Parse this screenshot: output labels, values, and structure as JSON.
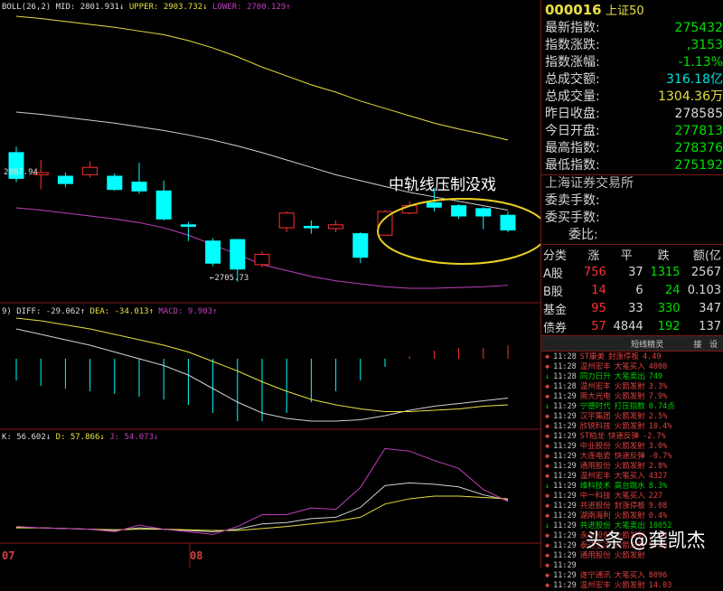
{
  "boll_panel": {
    "label_name": "BOLL(26,2)",
    "mid": "MID: 2801.931↓",
    "upper": "UPPER: 2903.732↓",
    "lower": "LOWER: 2700.129↑",
    "high_mark": "2887.94",
    "low_mark": "←2705.73",
    "annotation": "中轨线压制没戏"
  },
  "macd_panel": {
    "prefix": "9)",
    "diff": "DIFF: -29.062↑",
    "dea": "DEA: -34.013↑",
    "macd": "MACD: 9.903↑"
  },
  "kdj_panel": {
    "k": "K: 56.602↓",
    "d": "D: 57.866↓",
    "j": "J: 54.073↓"
  },
  "date_axis": [
    "07",
    "08"
  ],
  "quote": {
    "code": "000016",
    "name": "上证50",
    "rows": [
      {
        "label": "最新指数:",
        "value": "275432",
        "color": "#00e000"
      },
      {
        "label": "指数涨跌:",
        "value": ",3153",
        "color": "#00e000"
      },
      {
        "label": "指数涨幅:",
        "value": "-1.13%",
        "color": "#00e000"
      },
      {
        "label": "总成交额:",
        "value": "316.18亿",
        "color": "#00e0e0"
      },
      {
        "label": "总成交量:",
        "value": "1304.36万",
        "color": "#e8e040"
      },
      {
        "label": "昨日收盘:",
        "value": "278585",
        "color": "#d8d8d8"
      },
      {
        "label": "今日开盘:",
        "value": "277813",
        "color": "#00e000"
      },
      {
        "label": "最高指数:",
        "value": "278376",
        "color": "#00e000"
      },
      {
        "label": "最低指数:",
        "value": "275192",
        "color": "#00e000"
      }
    ],
    "exchange": "上海证券交易所",
    "order_rows": [
      {
        "label": "委卖手数:"
      },
      {
        "label": "委买手数:"
      },
      {
        "label": "委比:"
      }
    ]
  },
  "category_table": {
    "headers": [
      "分类",
      "涨",
      "平",
      "跌",
      "额(亿"
    ],
    "rows": [
      {
        "name": "A股",
        "up": "756",
        "flat": "37",
        "down": "1315",
        "amount": "2567"
      },
      {
        "name": "B股",
        "up": "14",
        "flat": "6",
        "down": "24",
        "amount": "0.103"
      },
      {
        "name": "基金",
        "up": "95",
        "flat": "33",
        "down": "330",
        "amount": "347"
      },
      {
        "name": "债券",
        "up": "57",
        "flat": "4844",
        "down": "192",
        "amount": "137"
      }
    ]
  },
  "short_elves": {
    "title": "短线精灵",
    "right_a": "接",
    "right_b": "设",
    "items": [
      {
        "time": "11:28",
        "name": "ST康美",
        "event": "封涨停板",
        "val": "4.49",
        "color": "#e04040"
      },
      {
        "time": "11:28",
        "name": "温州宏丰",
        "event": "大笔买入",
        "val": "4000",
        "color": "#e04040"
      },
      {
        "time": "11:28",
        "name": "同力日升",
        "event": "大笔卖出",
        "val": "749",
        "color": "#00d000"
      },
      {
        "time": "11:28",
        "name": "温州宏丰",
        "event": "火箭发射",
        "val": "3.3%",
        "color": "#e04040"
      },
      {
        "time": "11:29",
        "name": "南大光电",
        "event": "火箭发射",
        "val": "7.9%",
        "color": "#e04040"
      },
      {
        "time": "11:29",
        "name": "宁德时代",
        "event": "打压指数",
        "val": "0.74点",
        "color": "#00d000"
      },
      {
        "time": "11:29",
        "name": "汉宇集团",
        "event": "火箭发射",
        "val": "2.5%",
        "color": "#e04040"
      },
      {
        "time": "11:29",
        "name": "欣锐科技",
        "event": "火箭发射",
        "val": "10.4%",
        "color": "#e04040"
      },
      {
        "time": "11:29",
        "name": "ST柏龙",
        "event": "快速反弹",
        "val": "-2.7%",
        "color": "#e04040"
      },
      {
        "time": "11:29",
        "name": "中业股份",
        "event": "火箭发射",
        "val": "3.0%",
        "color": "#e04040"
      },
      {
        "time": "11:29",
        "name": "大连电瓷",
        "event": "快速反弹",
        "val": "-0.7%",
        "color": "#e04040"
      },
      {
        "time": "11:29",
        "name": "通用股份",
        "event": "火箭发射",
        "val": "2.8%",
        "color": "#e04040"
      },
      {
        "time": "11:29",
        "name": "温州宏丰",
        "event": "大笔买入",
        "val": "4327",
        "color": "#e04040"
      },
      {
        "time": "11:29",
        "name": "维科技术",
        "event": "高台跳水",
        "val": "8.3%",
        "color": "#00d000"
      },
      {
        "time": "11:29",
        "name": "中一科技",
        "event": "大笔买入",
        "val": "227",
        "color": "#e04040"
      },
      {
        "time": "11:29",
        "name": "共进股份",
        "event": "封涨停板",
        "val": "9.08",
        "color": "#e04040"
      },
      {
        "time": "11:29",
        "name": "湖南海利",
        "event": "火箭发射",
        "val": "0.4%",
        "color": "#e04040"
      },
      {
        "time": "11:29",
        "name": "共进股份",
        "event": "大笔卖出",
        "val": "10052",
        "color": "#00d000"
      },
      {
        "time": "11:29",
        "name": "永吉股份",
        "event": "火箭发射",
        "val": "1.2%",
        "color": "#e04040"
      },
      {
        "time": "11:29",
        "name": "泰达生活",
        "event": "火箭发射",
        "val": "9.2%",
        "color": "#e04040"
      },
      {
        "time": "11:29",
        "name": "通用股份",
        "event": "火箭发射",
        "val": "",
        "color": "#e04040"
      },
      {
        "time": "11:29",
        "name": "",
        "event": "",
        "val": "",
        "color": "#e04040"
      },
      {
        "time": "11:29",
        "name": "遂宁通讯",
        "event": "大笔买入",
        "val": "8096",
        "color": "#e04040"
      },
      {
        "time": "11:29",
        "name": "温州宏丰",
        "event": "火箭发射",
        "val": "14.03",
        "color": "#e04040"
      }
    ]
  },
  "watermark": "头条 @龚凯杰",
  "colors": {
    "up": "#ff3030",
    "down": "#00ffff",
    "mid_line": "#d0d0d0",
    "upper_line": "#e8e040",
    "lower_line": "#c040c0",
    "ellipse": "#e8d020"
  },
  "chart_data": {
    "type": "candlestick",
    "candles": [
      {
        "open": 2880,
        "close": 2845,
        "high": 2888,
        "low": 2840
      },
      {
        "open": 2850,
        "close": 2853,
        "high": 2870,
        "low": 2830
      },
      {
        "open": 2848,
        "close": 2838,
        "high": 2853,
        "low": 2833
      },
      {
        "open": 2850,
        "close": 2860,
        "high": 2868,
        "low": 2846
      },
      {
        "open": 2848,
        "close": 2830,
        "high": 2852,
        "low": 2828
      },
      {
        "open": 2840,
        "close": 2828,
        "high": 2866,
        "low": 2824
      },
      {
        "open": 2828,
        "close": 2790,
        "high": 2842,
        "low": 2788
      },
      {
        "open": 2782,
        "close": 2780,
        "high": 2786,
        "low": 2760
      },
      {
        "open": 2760,
        "close": 2730,
        "high": 2764,
        "low": 2726
      },
      {
        "open": 2762,
        "close": 2722,
        "high": 2763,
        "low": 2705
      },
      {
        "open": 2728,
        "close": 2742,
        "high": 2746,
        "low": 2724
      },
      {
        "open": 2778,
        "close": 2798,
        "high": 2800,
        "low": 2772
      },
      {
        "open": 2780,
        "close": 2778,
        "high": 2788,
        "low": 2770
      },
      {
        "open": 2777,
        "close": 2782,
        "high": 2788,
        "low": 2772
      },
      {
        "open": 2770,
        "close": 2738,
        "high": 2772,
        "low": 2730
      },
      {
        "open": 2768,
        "close": 2800,
        "high": 2802,
        "low": 2768
      },
      {
        "open": 2798,
        "close": 2808,
        "high": 2814,
        "low": 2796
      },
      {
        "open": 2812,
        "close": 2806,
        "high": 2832,
        "low": 2800
      },
      {
        "open": 2808,
        "close": 2794,
        "high": 2810,
        "low": 2790
      },
      {
        "open": 2804,
        "close": 2794,
        "high": 2806,
        "low": 2776
      },
      {
        "open": 2795,
        "close": 2775,
        "high": 2800,
        "low": 2772
      }
    ],
    "mid": [
      2935,
      2932,
      2928,
      2924,
      2920,
      2915,
      2910,
      2904,
      2897,
      2889,
      2880,
      2870,
      2860,
      2850,
      2842,
      2834,
      2826,
      2820,
      2814,
      2808,
      2802
    ],
    "upper": [
      3065,
      3062,
      3058,
      3054,
      3050,
      3045,
      3040,
      3032,
      3022,
      3010,
      2996,
      2984,
      2972,
      2962,
      2950,
      2940,
      2930,
      2920,
      2912,
      2905,
      2897
    ],
    "lower": [
      2805,
      2802,
      2798,
      2794,
      2790,
      2785,
      2778,
      2768,
      2755,
      2742,
      2728,
      2720,
      2712,
      2706,
      2702,
      2698,
      2696,
      2696,
      2697,
      2698,
      2700
    ],
    "macd_diff": [
      22,
      18,
      14,
      10,
      5,
      0,
      -5,
      -12,
      -22,
      -32,
      -40,
      -44,
      -46,
      -46,
      -45,
      -42,
      -38,
      -35,
      -33,
      -31,
      -29
    ],
    "macd_dea": [
      30,
      28,
      25,
      22,
      18,
      14,
      10,
      5,
      -2,
      -9,
      -17,
      -24,
      -30,
      -34,
      -37,
      -39,
      -39,
      -38,
      -37,
      -35,
      -34
    ],
    "macd_bars": [
      -16,
      -20,
      -22,
      -24,
      -26,
      -28,
      -30,
      -34,
      -40,
      -46,
      -46,
      -40,
      -32,
      -24,
      -16,
      -6,
      2,
      6,
      8,
      8,
      9.9
    ],
    "kdj_k": [
      15,
      14,
      13,
      12,
      10,
      14,
      12,
      10,
      8,
      12,
      20,
      22,
      28,
      30,
      45,
      78,
      82,
      80,
      76,
      64,
      56
    ],
    "kdj_d": [
      14,
      14,
      13,
      12,
      11,
      12,
      12,
      11,
      10,
      10,
      13,
      16,
      20,
      24,
      30,
      50,
      58,
      62,
      62,
      60,
      58
    ],
    "kdj_j": [
      16,
      14,
      13,
      12,
      8,
      18,
      12,
      8,
      4,
      16,
      34,
      34,
      44,
      42,
      75,
      134,
      130,
      116,
      104,
      72,
      54
    ]
  }
}
